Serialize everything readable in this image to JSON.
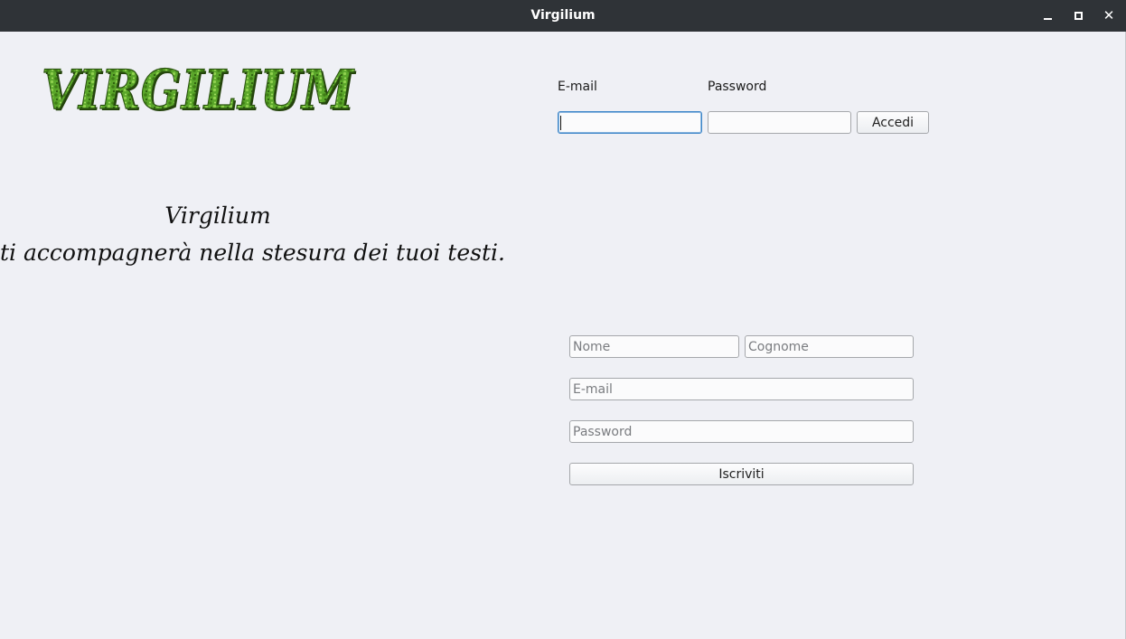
{
  "window": {
    "title": "Virgilium",
    "controls": {
      "minimize_icon": "minimize-icon",
      "maximize_icon": "maximize-icon",
      "close_icon": "close-icon",
      "close_glyph": "✕"
    }
  },
  "logo": {
    "text": "VIRGILIUM",
    "color": "#5aa62a"
  },
  "tagline": {
    "line1": "Virgilium",
    "line2": "ti accompagnerà nella stesura dei tuoi testi."
  },
  "login": {
    "email_label": "E-mail",
    "password_label": "Password",
    "email_value": "",
    "password_value": "",
    "submit_label": "Accedi"
  },
  "register": {
    "nome_placeholder": "Nome",
    "cognome_placeholder": "Cognome",
    "email_placeholder": "E-mail",
    "password_placeholder": "Password",
    "submit_label": "Iscriviti"
  },
  "colors": {
    "titlebar": "#2f3337",
    "background": "#eff0f5",
    "focus": "#3d86c9"
  }
}
